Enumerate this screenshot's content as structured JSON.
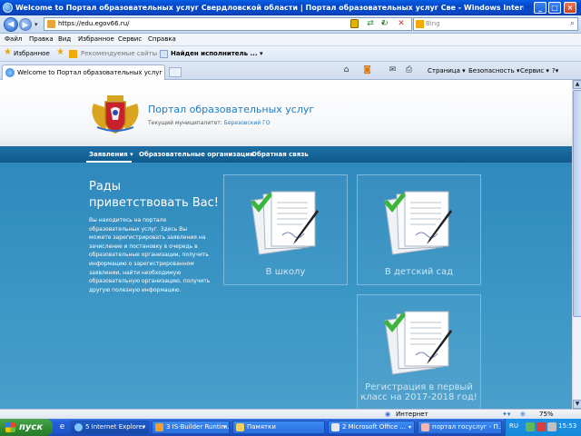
{
  "window": {
    "title": "Welcome to Портал образовательных услуг Свердловской области | Портал образовательных услуг Све - Windows Internet Explorer",
    "minimize": "_",
    "maximize": "□",
    "close": "×"
  },
  "address_bar": {
    "url": "https://edu.egov66.ru/",
    "search_placeholder": "Bing"
  },
  "menu": [
    "Файл",
    "Правка",
    "Вид",
    "Избранное",
    "Сервис",
    "Справка"
  ],
  "favorites_bar": {
    "favorites_label": "Избранное",
    "suggested_sites": "Рекомендуемые сайты ▾",
    "found_performer": "Найден исполнитель ... ▾"
  },
  "tabs": [
    {
      "label": "Welcome to Портал образовательных услуг Свердловск..."
    }
  ],
  "command_bar": {
    "page": "Страница ▾",
    "safety": "Безопасность ▾",
    "tools": "Сервис ▾",
    "help": "?▾"
  },
  "site": {
    "title": "Портал образовательных услуг",
    "municipality_label": "Текущий муниципалитет:",
    "municipality": "Березовский ГО",
    "nav": {
      "applications": "Заявления ▾",
      "organizations": "Образовательные организации",
      "feedback": "Обратная связь"
    },
    "welcome_title_1": "Рады",
    "welcome_title_2": "приветствовать Вас!",
    "welcome_text": "Вы находитесь на портале образовательных услуг. Здесь Вы можете зарегистрировать заявления на зачисление и постановку в очередь в образовательные организации, получить информацию о зарегистрированном заявлении, найти необходимую образовательную организацию, получить другую полезную информацию.",
    "cards": [
      {
        "label": "В школу"
      },
      {
        "label": "В детский сад"
      },
      {
        "label_1": "Регистрация в первый",
        "label_2": "класс на 2017-2018 год!"
      }
    ]
  },
  "status_bar": {
    "zone": "Интернет",
    "zoom": "75%"
  },
  "taskbar": {
    "start": "пуск",
    "buttons": [
      {
        "label": "5 Internet Explorer"
      },
      {
        "label": "3 IS-Builder Runtim..."
      },
      {
        "label": "Памятки"
      },
      {
        "label": "2 Microsoft Office ..."
      },
      {
        "label": "портал госуслуг - П..."
      }
    ],
    "language": "RU",
    "clock": "15:53"
  },
  "colors": {
    "site_accent": "#1c7bc6",
    "site_main_bg": "#3a95c5",
    "nav_strip": "#105a8c"
  }
}
